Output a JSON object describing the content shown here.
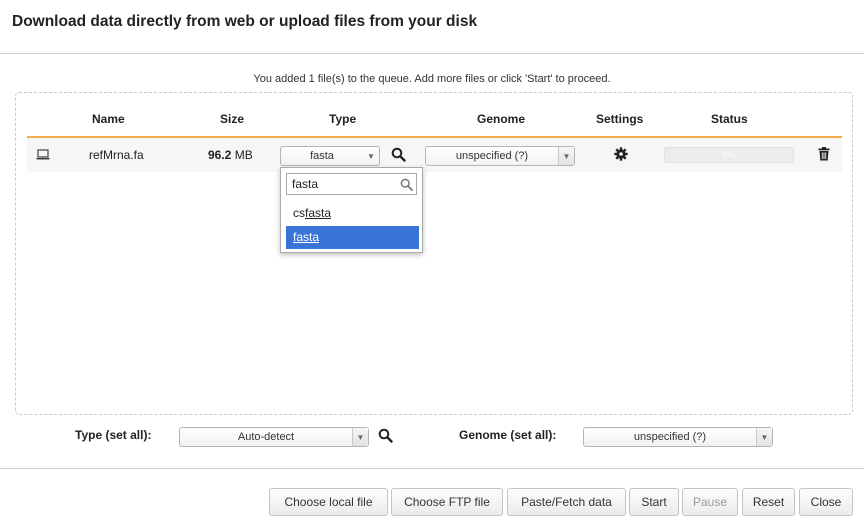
{
  "dialog": {
    "title": "Download data directly from web or upload files from your disk",
    "queue_message": "You added 1 file(s) to the queue. Add more files or click 'Start' to proceed."
  },
  "table": {
    "headers": [
      "Name",
      "Size",
      "Type",
      "Genome",
      "Settings",
      "Status"
    ],
    "rows": [
      {
        "name": "refMrna.fa",
        "size_value": "96.2",
        "size_unit": "MB",
        "type": "fasta",
        "genome": "unspecified (?)",
        "status": "0%"
      }
    ]
  },
  "type_dropdown": {
    "search_value": "fasta",
    "options": [
      {
        "prefix": "cs",
        "match": "fasta",
        "selected": false
      },
      {
        "prefix": "",
        "match": "fasta",
        "selected": true
      }
    ],
    "highlight_color": "#3875d7"
  },
  "set_all": {
    "type_label": "Type (set all):",
    "type_value": "Auto-detect",
    "genome_label": "Genome (set all):",
    "genome_value": "unspecified (?)"
  },
  "buttons": {
    "choose_local": "Choose local file",
    "choose_ftp": "Choose FTP file",
    "paste_fetch": "Paste/Fetch data",
    "start": "Start",
    "pause": "Pause",
    "reset": "Reset",
    "close": "Close"
  },
  "colors": {
    "header_underline": "#f0ad4e"
  },
  "icons": {
    "row_file": "laptop-icon",
    "type_search": "search-icon",
    "settings": "gear-icon",
    "delete": "trash-icon",
    "set_all_type_search": "search-icon"
  }
}
